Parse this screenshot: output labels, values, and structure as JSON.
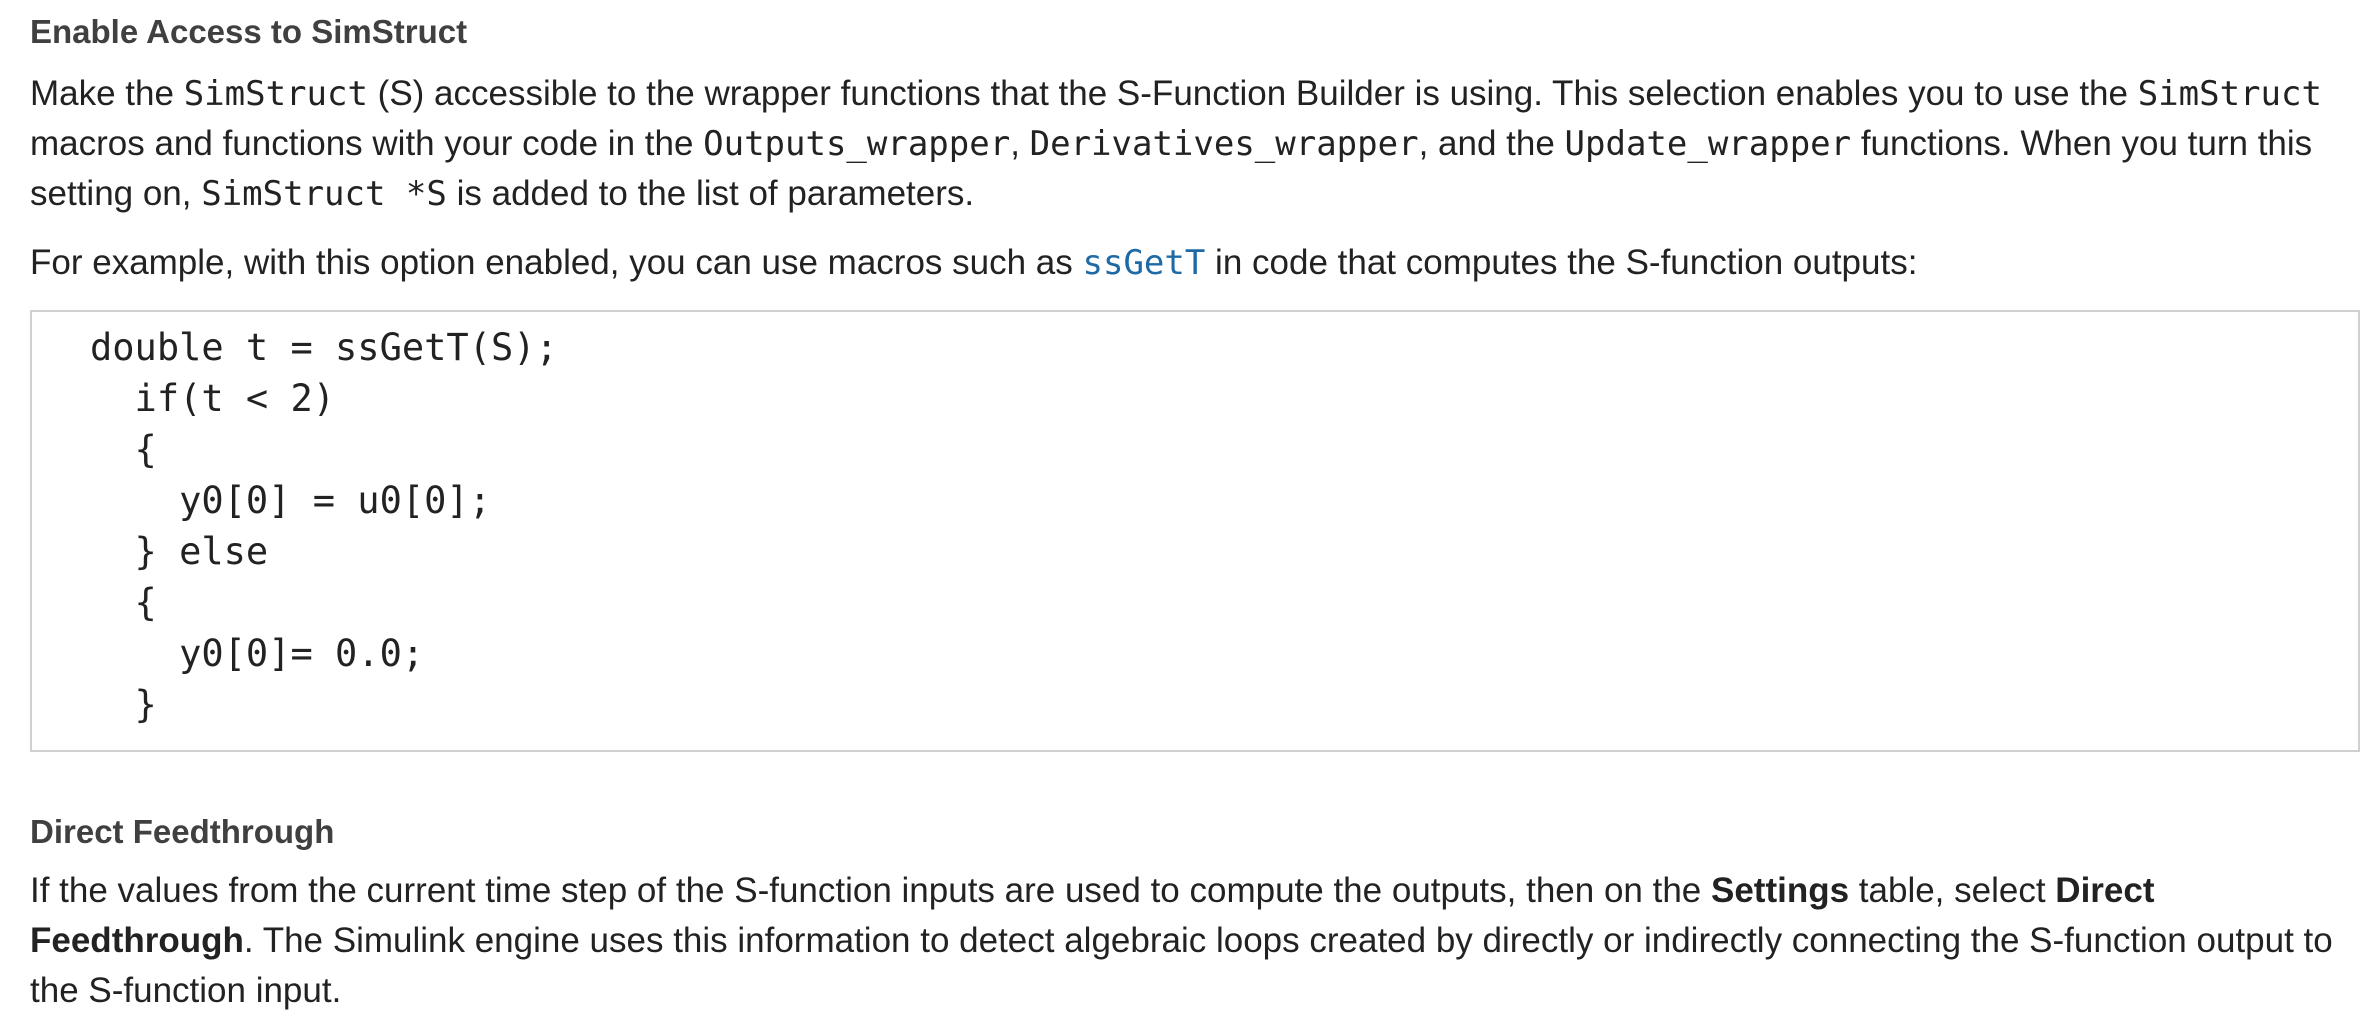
{
  "section1": {
    "heading": "Enable Access to SimStruct",
    "para1": {
      "t1": "Make the ",
      "c1": "SimStruct",
      "t2": " (S) accessible to the wrapper functions that the S-Function Builder is using. This selection enables you to use the ",
      "c2": "SimStruct",
      "t3": " macros and functions with your code in the ",
      "c3": "Outputs_wrapper",
      "t4": ", ",
      "c4": "Derivatives_wrapper",
      "t5": ", and the ",
      "c5": "Update_wrapper",
      "t6": " functions. When you turn this setting on, ",
      "c6": "SimStruct *S",
      "t7": " is added to the list of parameters."
    },
    "para2": {
      "t1": "For example, with this option enabled, you can use macros such as ",
      "link": "ssGetT",
      "t2": " in code that computes the S-function outputs:"
    },
    "code_lines": [
      "double t = ssGetT(S);",
      "  if(t < 2)",
      "  {",
      "    y0[0] = u0[0];",
      "  } else",
      "  {",
      "    y0[0]= 0.0;",
      "  }"
    ]
  },
  "section2": {
    "heading": "Direct Feedthrough",
    "para": {
      "t1": "If the values from the current time step of the S-function inputs are used to compute the outputs, then on the ",
      "b1": "Settings",
      "t2": " table, select ",
      "b2": "Direct Feedthrough",
      "t3": ". The Simulink engine uses this information to detect algebraic loops created by directly or indirectly connecting the S-function output to the S-function input."
    }
  }
}
